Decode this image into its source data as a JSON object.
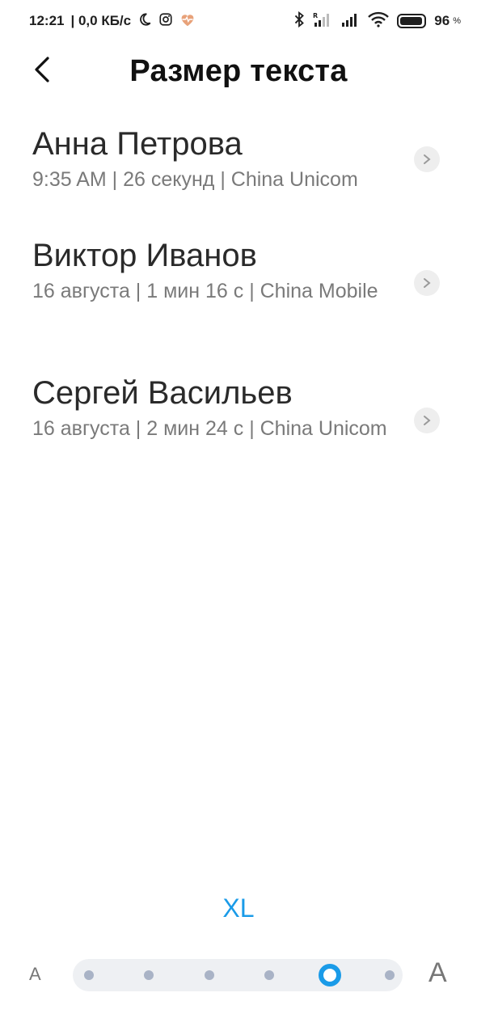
{
  "status_bar": {
    "time": "12:21",
    "network_speed": "| 0,0 КБ/с",
    "battery_level": "96",
    "battery_percent_sign": "%"
  },
  "header": {
    "title": "Размер текста"
  },
  "calls": [
    {
      "name": "Анна Петрова",
      "meta": "9:35 AM | 26 секунд | China Unicom"
    },
    {
      "name": "Виктор Иванов",
      "meta": "16 августа | 1 мин 16 с | China Mobile"
    },
    {
      "name": "Сергей Васильев",
      "meta": "16 августа | 2 мин 24 с | China Unicom"
    }
  ],
  "text_size": {
    "current_label": "XL",
    "small_label": "A",
    "large_label": "A",
    "steps": 6,
    "selected_index": 4
  },
  "colors": {
    "accent": "#1a9be8",
    "dot": "#a9b3c6",
    "track": "#eef0f3"
  }
}
